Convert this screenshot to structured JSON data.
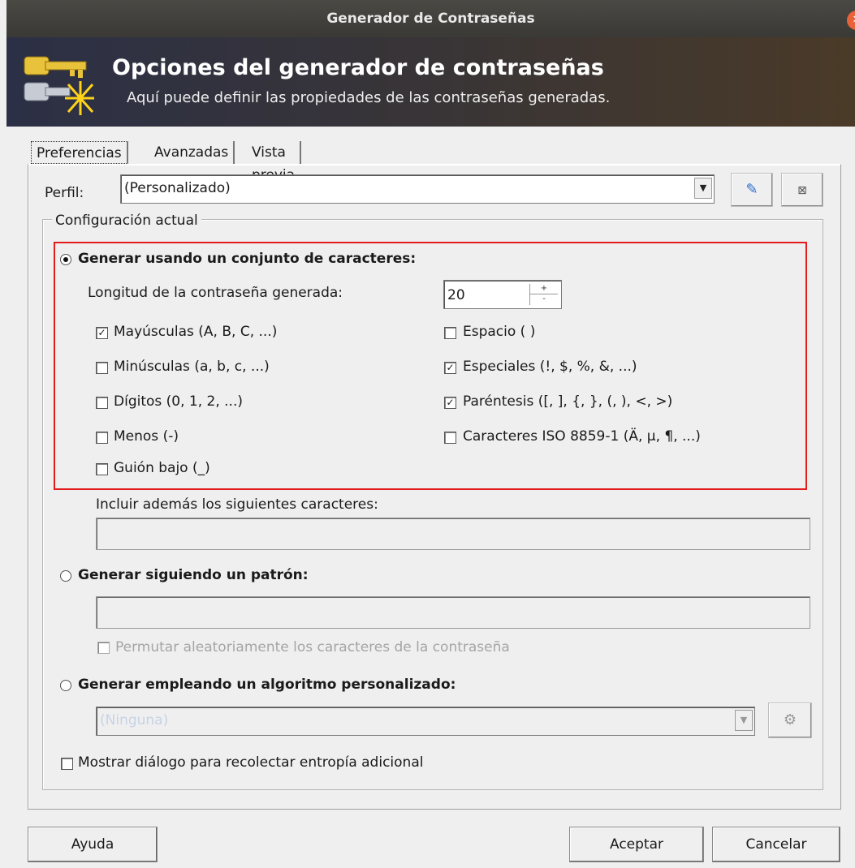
{
  "window": {
    "title": "Generador de Contraseñas"
  },
  "banner": {
    "heading": "Opciones del generador de contraseñas",
    "subheading": "Aquí puede definir las propiedades de las contraseñas generadas."
  },
  "tabs": [
    {
      "label": "Preferencias",
      "active": true
    },
    {
      "label": "Avanzadas",
      "active": false
    },
    {
      "label": "Vista previa",
      "active": false
    }
  ],
  "profile": {
    "label": "Perfil:",
    "value": "(Personalizado)"
  },
  "group": {
    "title": "Configuración actual"
  },
  "charset": {
    "radio_label": "Generar usando un conjunto de caracteres:",
    "selected": true,
    "length_label": "Longitud de la contraseña generada:",
    "length_value": "20",
    "options_left": [
      {
        "label": "Mayúsculas (A, B, C, ...)",
        "checked": true
      },
      {
        "label": "Minúsculas (a, b, c, ...)",
        "checked": false
      },
      {
        "label": "Dígitos (0, 1, 2, ...)",
        "checked": false
      },
      {
        "label": "Menos (-)",
        "checked": false
      },
      {
        "label": "Guión bajo (_)",
        "checked": false
      }
    ],
    "options_right": [
      {
        "label": "Espacio ( )",
        "checked": false
      },
      {
        "label": "Especiales (!, $, %, &, ...)",
        "checked": true
      },
      {
        "label": "Paréntesis ([, ], {, }, (, ), <, >)",
        "checked": true
      },
      {
        "label": "Caracteres ISO 8859-1 (Ä, µ, ¶, ...)",
        "checked": false
      }
    ]
  },
  "extra": {
    "label": "Incluir además los siguientes caracteres:",
    "value": ""
  },
  "pattern": {
    "radio_label": "Generar siguiendo un patrón:",
    "selected": false,
    "value": "",
    "permute_label": "Permutar aleatoriamente los caracteres de la contraseña",
    "permute_checked": false
  },
  "custom": {
    "radio_label": "Generar empleando un algoritmo personalizado:",
    "selected": false,
    "value": "(Ninguna)"
  },
  "entropy": {
    "label": "Mostrar diálogo para recolectar entropía adicional",
    "checked": false
  },
  "buttons": {
    "help": "Ayuda",
    "ok": "Aceptar",
    "cancel": "Cancelar"
  },
  "icons": {
    "save": "save-profile-icon",
    "delete": "delete-profile-icon",
    "settings": "settings-icon",
    "logo": "keys-logo-icon"
  },
  "colors": {
    "highlight_box": "#e31b1b",
    "titlebar": "#3f3e3a",
    "close": "#e8623a"
  }
}
